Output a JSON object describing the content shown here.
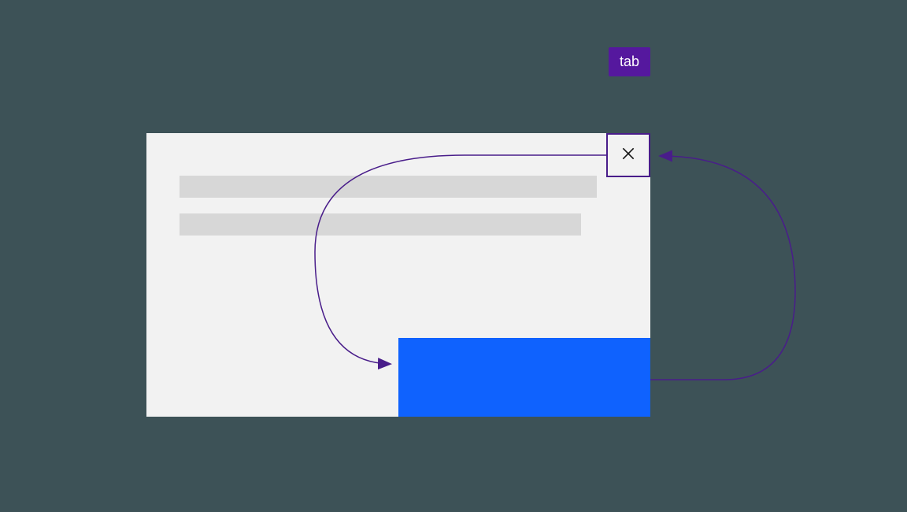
{
  "badge": {
    "label": "tab"
  },
  "modal": {
    "close_button": {
      "icon": "close-icon"
    },
    "content_lines": 2,
    "primary_button": {
      "label": ""
    }
  },
  "diagram": {
    "description": "Focus trap tab order: close button → primary action button → close button (loop)",
    "arrows": [
      {
        "from": "close-button",
        "to": "primary-button"
      },
      {
        "from": "primary-button",
        "to": "close-button"
      }
    ]
  },
  "colors": {
    "background": "#3d5257",
    "modal_bg": "#f2f2f2",
    "placeholder": "#d7d7d7",
    "primary": "#0f62fe",
    "accent": "#491d8a",
    "badge": "#55189e"
  }
}
